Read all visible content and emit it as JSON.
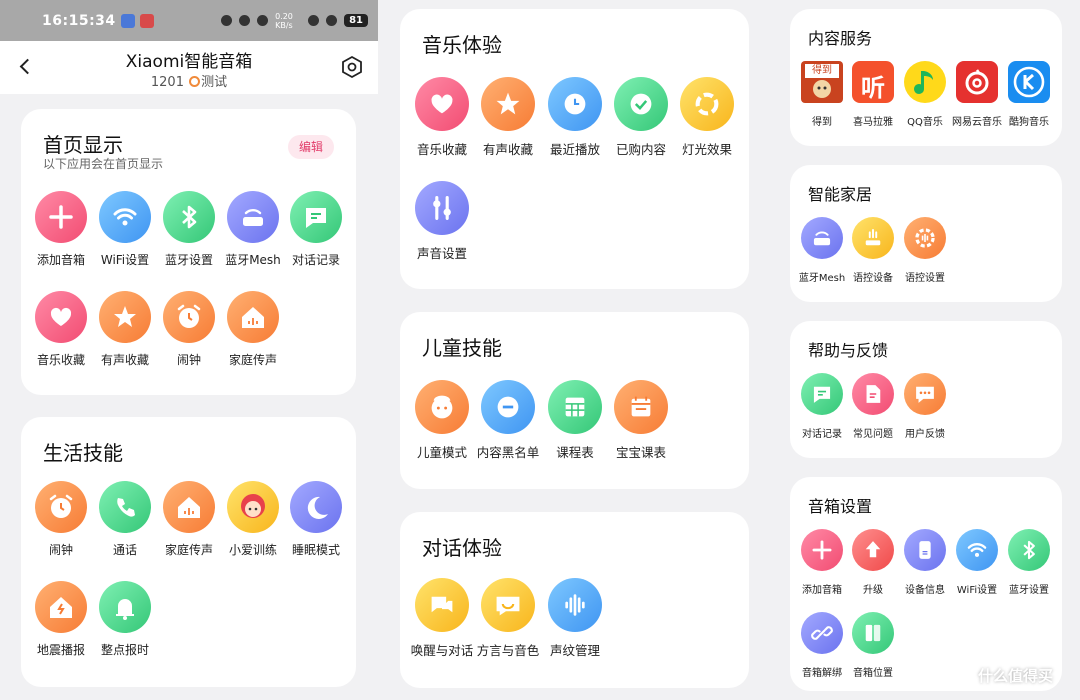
{
  "statusbar": {
    "time": "16:15:34",
    "speed": "0.20 KB/s",
    "battery": "81"
  },
  "header": {
    "title": "Xiaomi智能音箱",
    "subtitle_prefix": "1201",
    "subtitle_suffix": "测试"
  },
  "home": {
    "title": "首页显示",
    "desc": "以下应用会在首页显示",
    "edit": "编辑",
    "items": [
      "添加音箱",
      "WiFi设置",
      "蓝牙设置",
      "蓝牙Mesh",
      "对话记录",
      "音乐收藏",
      "有声收藏",
      "闹钟",
      "家庭传声"
    ]
  },
  "life": {
    "title": "生活技能",
    "items": [
      "闹钟",
      "通话",
      "家庭传声",
      "小爱训练",
      "睡眠模式",
      "地震播报",
      "整点报时"
    ]
  },
  "music": {
    "title": "音乐体验",
    "items": [
      "音乐收藏",
      "有声收藏",
      "最近播放",
      "已购内容",
      "灯光效果",
      "声音设置"
    ]
  },
  "kids": {
    "title": "儿童技能",
    "items": [
      "儿童模式",
      "内容黑名单",
      "课程表",
      "宝宝课表"
    ]
  },
  "dialog": {
    "title": "对话体验",
    "items": [
      "唤醒与对话",
      "方言与音色",
      "声纹管理"
    ]
  },
  "content": {
    "title": "内容服务",
    "items": [
      "得到",
      "喜马拉雅",
      "QQ音乐",
      "网易云音乐",
      "酷狗音乐"
    ],
    "logo_text": {
      "dedao": "得到",
      "ximalaya": "听"
    }
  },
  "smarthome": {
    "title": "智能家居",
    "items": [
      "蓝牙Mesh",
      "语控设备",
      "语控设置"
    ]
  },
  "help": {
    "title": "帮助与反馈",
    "items": [
      "对话记录",
      "常见问题",
      "用户反馈"
    ]
  },
  "speaker": {
    "title": "音箱设置",
    "items": [
      "添加音箱",
      "升级",
      "设备信息",
      "WiFi设置",
      "蓝牙设置",
      "音箱解绑",
      "音箱位置"
    ]
  },
  "watermark": "什么值得买",
  "colors": {
    "edit_bg": "#fde8ee",
    "edit_text": "#e23c6a",
    "ximalaya": "#f4512c",
    "netease": "#e5312f",
    "kugou": "#1a8df0",
    "qq_music": "#ffd91a"
  }
}
